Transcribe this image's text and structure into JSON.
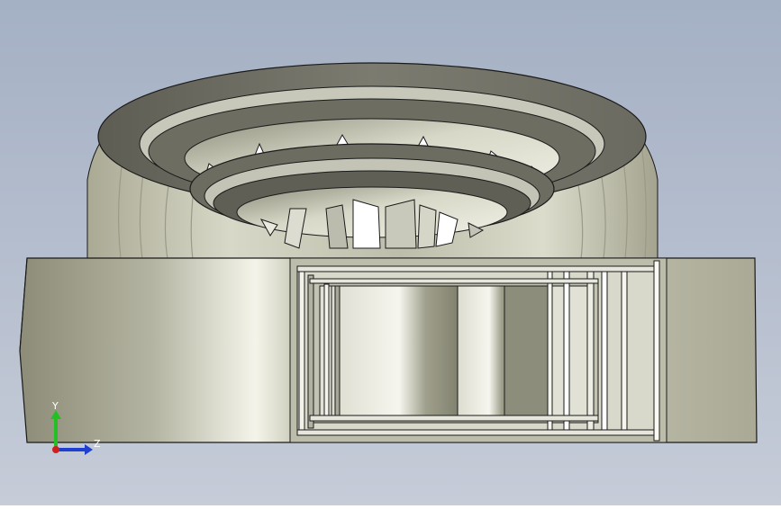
{
  "viewport": {
    "background_top": "#a4b0c4",
    "background_bottom": "#c6ccd8",
    "model_color": "#c9c9bd",
    "edge_color": "#1a1a1a"
  },
  "triad": {
    "y_label": "Y",
    "z_label": "Z",
    "x_label": "",
    "y_color": "#22c022",
    "z_color": "#1f3fd0",
    "x_color": "#d01f1f"
  }
}
